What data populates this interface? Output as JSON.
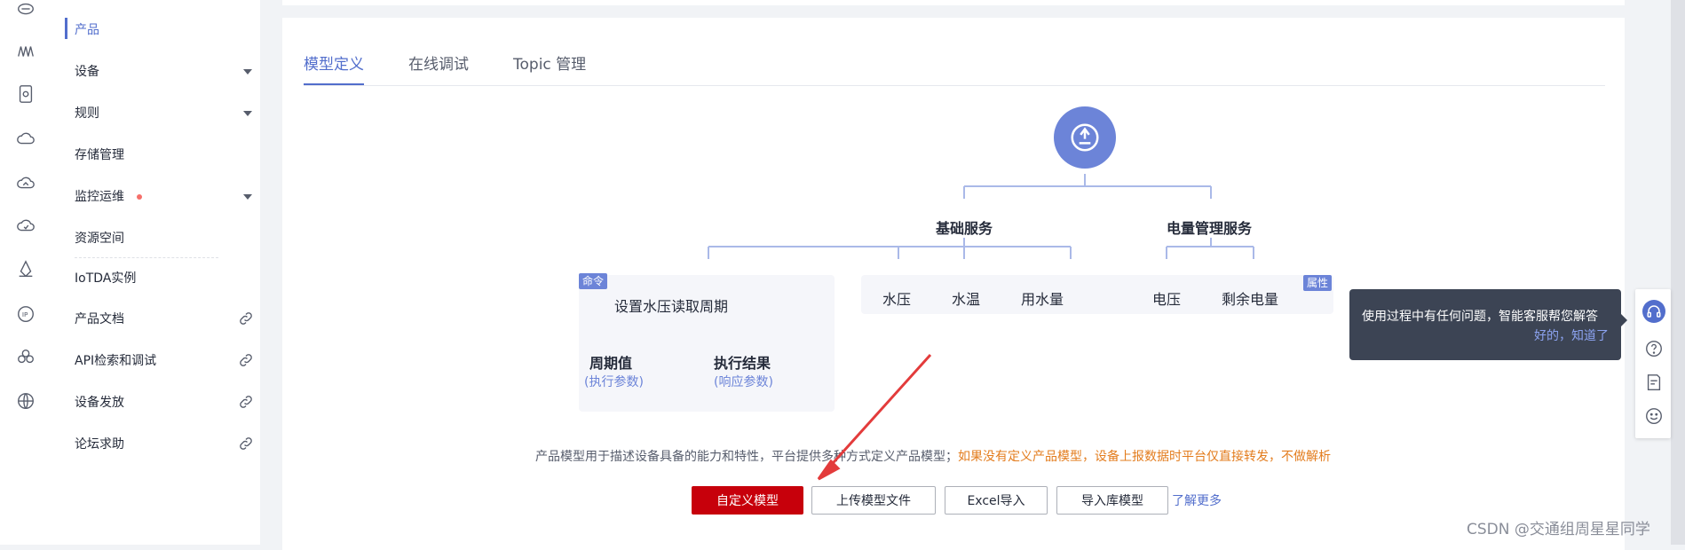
{
  "rail": {
    "icons": [
      "cloud-icon",
      "waveform-icon",
      "device-icon",
      "cloud-outline-icon",
      "cloud-home-icon",
      "cloud-sync-icon",
      "diamond-icon",
      "ip-icon",
      "cluster-icon",
      "globe-icon"
    ]
  },
  "sidebar": {
    "items": [
      {
        "label": "产品",
        "active": true
      },
      {
        "label": "设备",
        "caret": true
      },
      {
        "label": "规则",
        "caret": true
      },
      {
        "label": "存储管理"
      },
      {
        "label": "监控运维",
        "caret": true,
        "dot": true
      },
      {
        "label": "资源空间"
      },
      {
        "label": "IoTDA实例"
      },
      {
        "label": "产品文档",
        "link": true
      },
      {
        "label": "API检索和调试",
        "link": true
      },
      {
        "label": "设备发放",
        "link": true
      },
      {
        "label": "论坛求助",
        "link": true
      }
    ]
  },
  "tabs": [
    {
      "label": "模型定义",
      "active": true
    },
    {
      "label": "在线调试"
    },
    {
      "label": "Topic 管理"
    }
  ],
  "diagram": {
    "services": [
      "基础服务",
      "电量管理服务"
    ],
    "command_tag": "命令",
    "property_tag": "属性",
    "command_name": "设置水压读取周期",
    "command_params": [
      {
        "name": "周期值",
        "sub": "(执行参数)"
      },
      {
        "name": "执行结果",
        "sub": "(响应参数)"
      }
    ],
    "properties": [
      "水压",
      "水温",
      "用水量",
      "电压",
      "剩余电量"
    ]
  },
  "description": {
    "text": "产品模型用于描述设备具备的能力和特性，平台提供多种方式定义产品模型；",
    "warning": "如果没有定义产品模型，设备上报数据时平台仅直接转发，不做解析"
  },
  "buttons": {
    "custom": "自定义模型",
    "upload": "上传模型文件",
    "excel": "Excel导入",
    "library": "导入库模型",
    "learn_more": "了解更多"
  },
  "tooltip": {
    "text": "使用过程中有任何问题，智能客服帮您解答",
    "ok": "好的，知道了"
  },
  "float_icons": [
    "headset-icon",
    "help-icon",
    "feedback-icon",
    "smile-icon"
  ],
  "watermark": "CSDN @交通组周星星同学",
  "colors": {
    "accent": "#526ecc",
    "primary_button": "#c7000b",
    "warning": "#e37c1d",
    "tooltip_bg": "#3c4454"
  }
}
